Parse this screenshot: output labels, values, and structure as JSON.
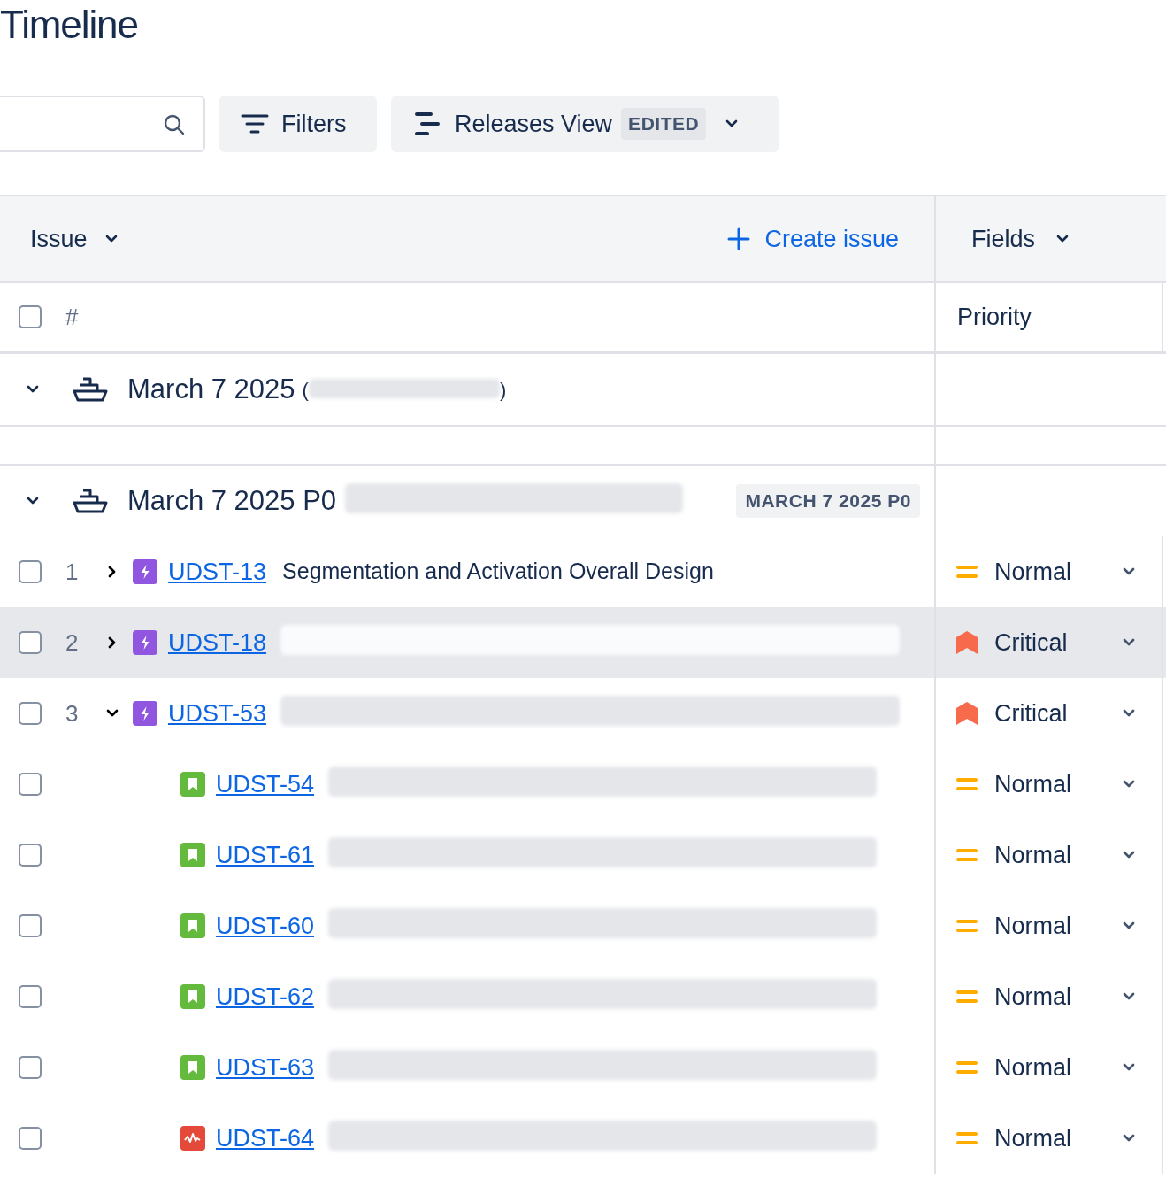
{
  "page_title": "Timeline",
  "toolbar": {
    "filters_button": "Filters",
    "view_button": {
      "label": "Releases View",
      "badge": "EDITED"
    }
  },
  "table_header": {
    "issue_menu": "Issue",
    "create_issue": "Create issue",
    "fields_menu": "Fields"
  },
  "columns": {
    "select_all_checked": false,
    "number": "#",
    "priority": "Priority"
  },
  "releases": [
    {
      "name": "March 7 2025",
      "paren_open": "(",
      "paren_close": ")",
      "expanded": true
    },
    {
      "name": "March 7 2025 P0",
      "tag": "MARCH 7 2025 P0",
      "expanded": true,
      "issues": [
        {
          "number": "1",
          "key": "UDST-13",
          "kind": "epic",
          "summary": "Segmentation and Activation Overall Design",
          "priority": "Normal",
          "checked": false,
          "selected": false,
          "expanded": false
        },
        {
          "number": "2",
          "key": "UDST-18",
          "kind": "epic",
          "priority": "Critical",
          "checked": false,
          "selected": true,
          "expanded": false
        },
        {
          "number": "3",
          "key": "UDST-53",
          "kind": "epic",
          "priority": "Critical",
          "checked": false,
          "selected": false,
          "expanded": true,
          "children": [
            {
              "key": "UDST-54",
              "kind": "story",
              "priority": "Normal",
              "checked": false
            },
            {
              "key": "UDST-61",
              "kind": "story",
              "priority": "Normal",
              "checked": false
            },
            {
              "key": "UDST-60",
              "kind": "story",
              "priority": "Normal",
              "checked": false
            },
            {
              "key": "UDST-62",
              "kind": "story",
              "priority": "Normal",
              "checked": false
            },
            {
              "key": "UDST-63",
              "kind": "story",
              "priority": "Normal",
              "checked": false
            },
            {
              "key": "UDST-64",
              "kind": "bug",
              "priority": "Normal",
              "checked": false
            }
          ]
        }
      ]
    }
  ]
}
